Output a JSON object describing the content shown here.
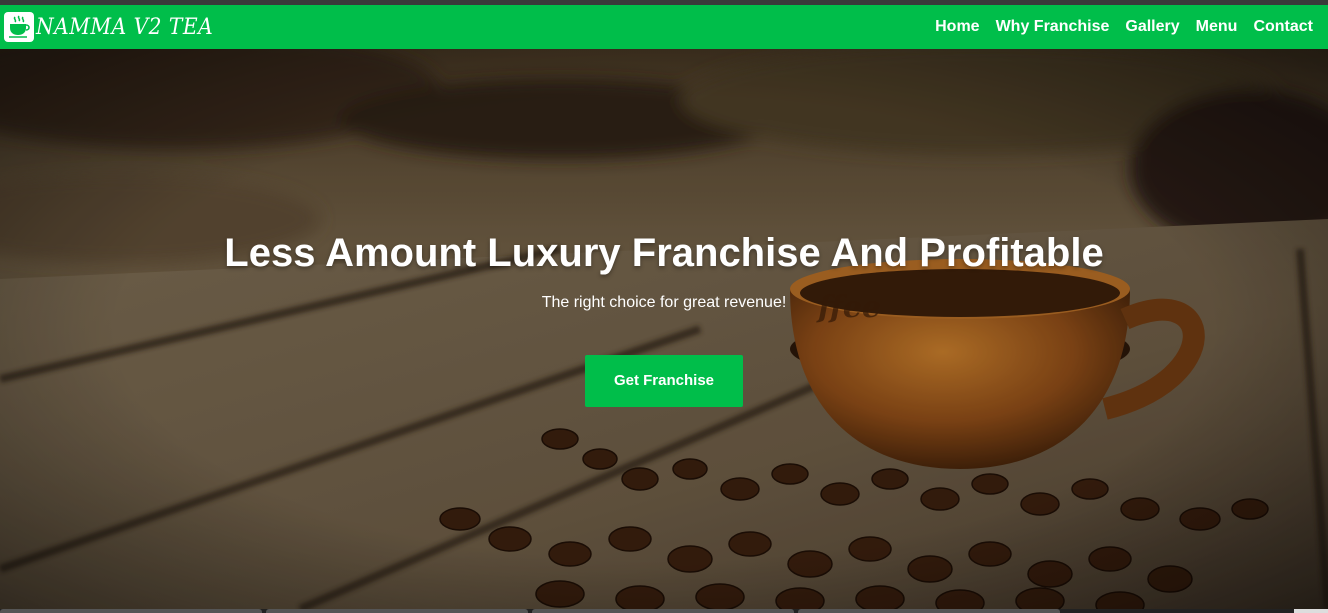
{
  "brand": {
    "name": "NAMMA V2 TEA",
    "logo_icon": "tea-cup-logo-icon"
  },
  "nav": {
    "items": [
      {
        "label": "Home"
      },
      {
        "label": "Why Franchise"
      },
      {
        "label": "Gallery"
      },
      {
        "label": "Menu"
      },
      {
        "label": "Contact"
      }
    ]
  },
  "hero": {
    "title": "Less Amount Luxury Franchise And Profitable",
    "subtitle": "The right choice for great revenue!",
    "button_label": "Get Franchise",
    "background": "coffee-cup-and-beans-photo"
  },
  "colors": {
    "accent": "#00be4a",
    "text_on_accent": "#ffffff"
  }
}
